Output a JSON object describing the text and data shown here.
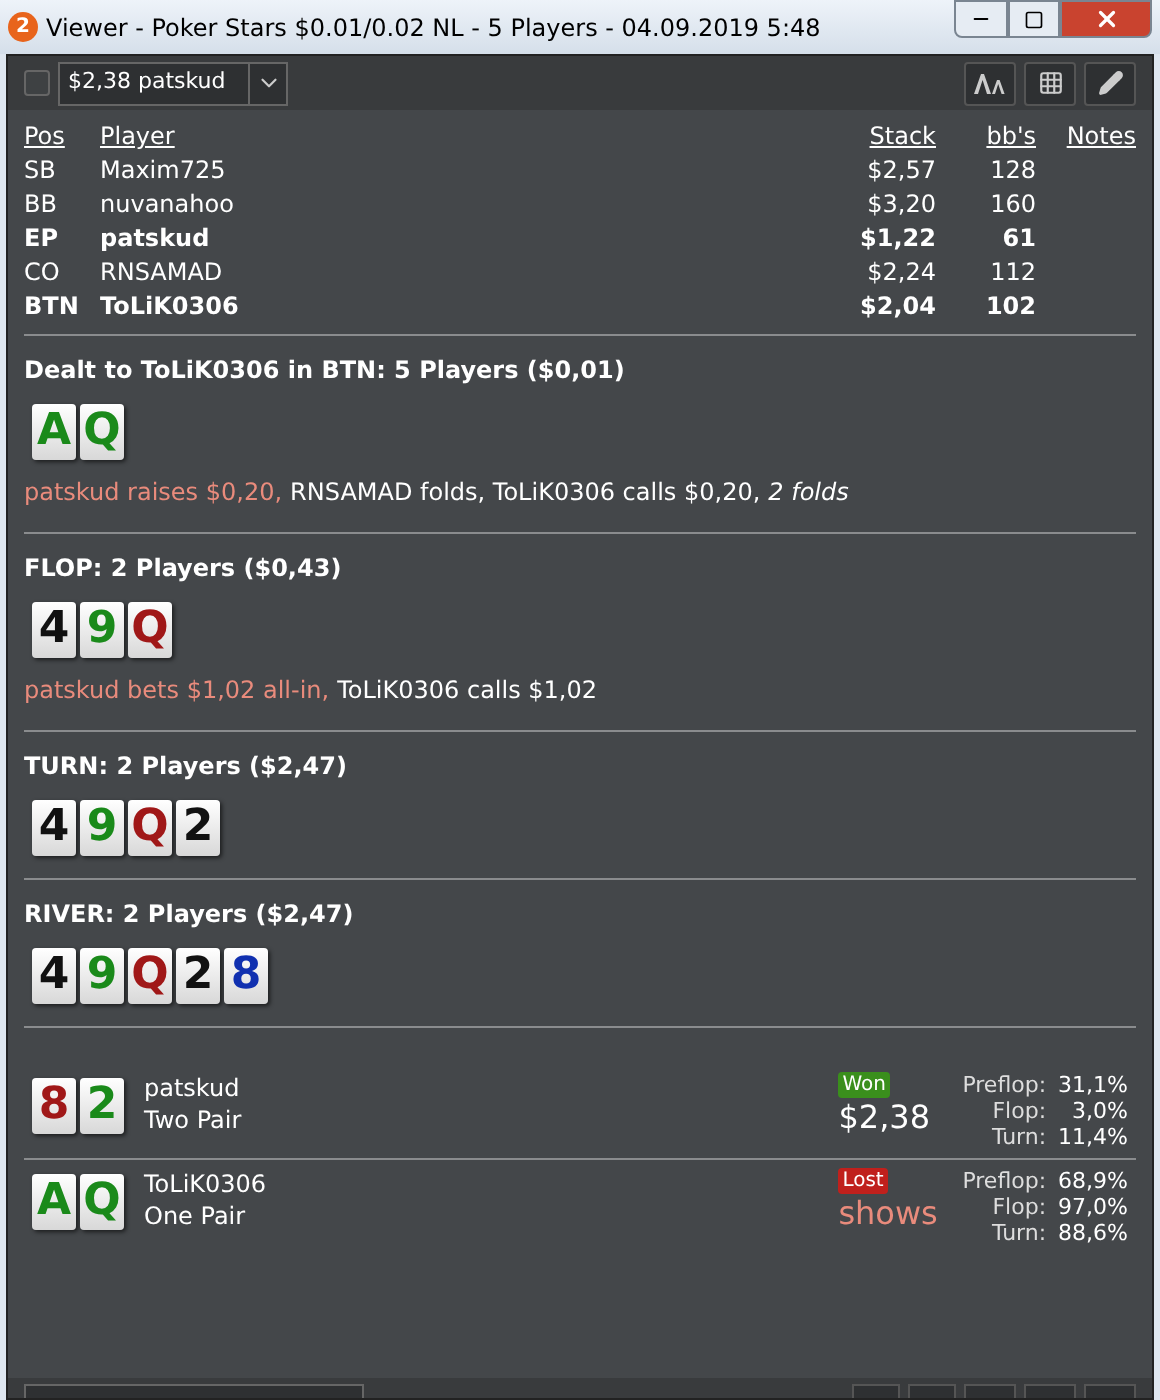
{
  "window": {
    "badge": "2",
    "title": "Viewer - Poker Stars $0.01/0.02 NL - 5 Players - 04.09.2019 5:48"
  },
  "toolbar": {
    "checked": false,
    "player_select": "$2,38 patskud"
  },
  "players": {
    "columns": [
      "Pos",
      "Player",
      "Stack",
      "bb's",
      "Notes"
    ],
    "rows": [
      {
        "pos": "SB",
        "player": "Maxim725",
        "stack": "$2,57",
        "bbs": "128",
        "bold": false
      },
      {
        "pos": "BB",
        "player": "nuvanahoo",
        "stack": "$3,20",
        "bbs": "160",
        "bold": false
      },
      {
        "pos": "EP",
        "player": "patskud",
        "stack": "$1,22",
        "bbs": "61",
        "bold": true
      },
      {
        "pos": "CO",
        "player": "RNSAMAD",
        "stack": "$2,24",
        "bbs": "112",
        "bold": false
      },
      {
        "pos": "BTN",
        "player": "ToLiK0306",
        "stack": "$2,04",
        "bbs": "102",
        "bold": true
      }
    ]
  },
  "streets": [
    {
      "title": "Dealt to ToLiK0306 in BTN: 5 Players ($0,01)",
      "cards": [
        {
          "rank": "A",
          "color": "#1a8a1a"
        },
        {
          "rank": "Q",
          "color": "#1a8a1a"
        }
      ],
      "actions": [
        {
          "kind": "hero",
          "text": "patskud raises $0,20,"
        },
        {
          "kind": "normal",
          "text": "RNSAMAD folds, ToLiK0306 calls $0,20,"
        },
        {
          "kind": "summary",
          "text": "2 folds"
        }
      ]
    },
    {
      "title": "FLOP: 2 Players ($0,43)",
      "cards": [
        {
          "rank": "4",
          "color": "#111111"
        },
        {
          "rank": "9",
          "color": "#1a8a1a"
        },
        {
          "rank": "Q",
          "color": "#a01818"
        }
      ],
      "actions": [
        {
          "kind": "hero",
          "text": "patskud bets $1,02 all-in,"
        },
        {
          "kind": "normal",
          "text": "ToLiK0306 calls $1,02"
        }
      ]
    },
    {
      "title": "TURN: 2 Players ($2,47)",
      "cards": [
        {
          "rank": "4",
          "color": "#111111"
        },
        {
          "rank": "9",
          "color": "#1a8a1a"
        },
        {
          "rank": "Q",
          "color": "#a01818"
        },
        {
          "rank": "2",
          "color": "#111111"
        }
      ]
    },
    {
      "title": "RIVER: 2 Players ($2,47)",
      "cards": [
        {
          "rank": "4",
          "color": "#111111"
        },
        {
          "rank": "9",
          "color": "#1a8a1a"
        },
        {
          "rank": "Q",
          "color": "#a01818"
        },
        {
          "rank": "2",
          "color": "#111111"
        },
        {
          "rank": "8",
          "color": "#1030b0"
        }
      ]
    }
  ],
  "showdown": [
    {
      "cards": [
        {
          "rank": "8",
          "color": "#a01818"
        },
        {
          "rank": "2",
          "color": "#1a8a1a"
        }
      ],
      "name": "patskud",
      "hand": "Two Pair",
      "result": {
        "kind": "won",
        "label": "Won",
        "detail": "$2,38"
      },
      "equity": [
        {
          "label": "Preflop:",
          "value": "31,1%"
        },
        {
          "label": "Flop:",
          "value": "3,0%"
        },
        {
          "label": "Turn:",
          "value": "11,4%"
        }
      ]
    },
    {
      "cards": [
        {
          "rank": "A",
          "color": "#1a8a1a"
        },
        {
          "rank": "Q",
          "color": "#1a8a1a"
        }
      ],
      "name": "ToLiK0306",
      "hand": "One Pair",
      "result": {
        "kind": "lost",
        "label": "Lost",
        "detail": "shows"
      },
      "equity": [
        {
          "label": "Preflop:",
          "value": "68,9%"
        },
        {
          "label": "Flop:",
          "value": "97,0%"
        },
        {
          "label": "Turn:",
          "value": "88,6%"
        }
      ]
    }
  ]
}
